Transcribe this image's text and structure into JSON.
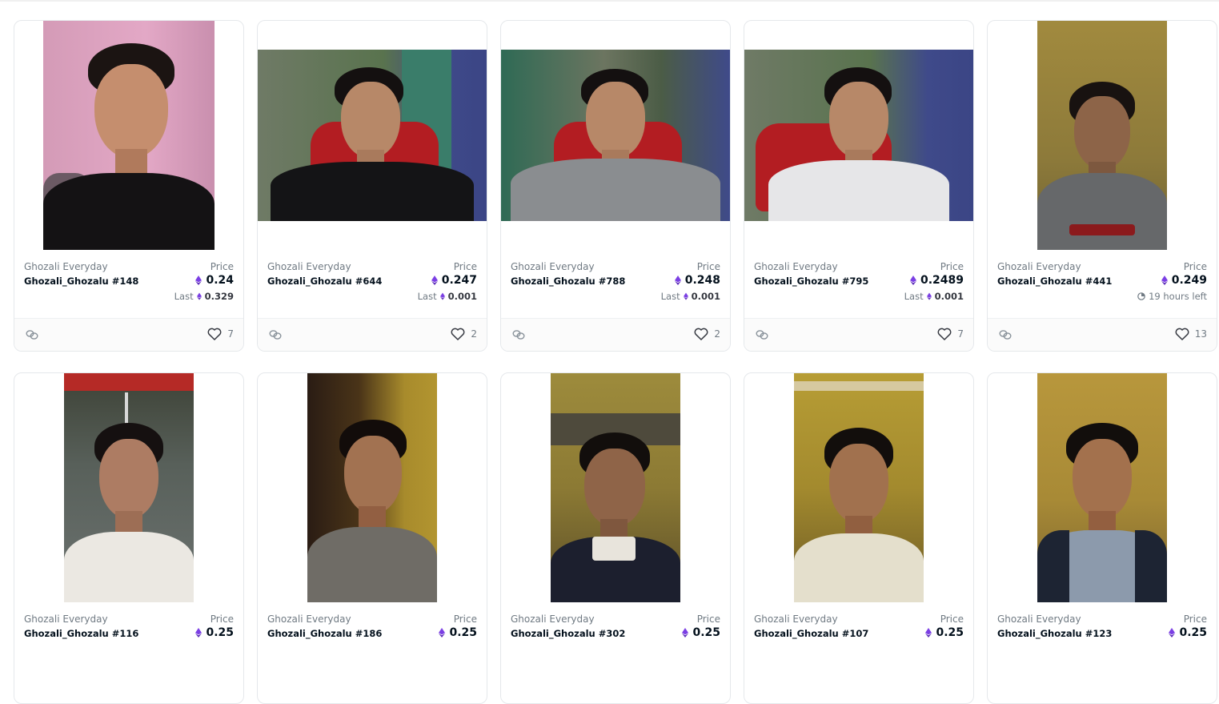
{
  "labels": {
    "price": "Price",
    "last": "Last"
  },
  "colors": {
    "eth_purple": "#7b3fe4",
    "muted": "#707a83",
    "ink": "#04111d"
  },
  "icons": {
    "currency": "ethereum-icon",
    "bundle": "chain-link-icon",
    "favorite": "heart-icon",
    "timer": "clock-icon"
  },
  "cards": [
    {
      "collection": "Ghozali Everyday",
      "token": "Ghozali_Ghozalu #148",
      "price": "0.24",
      "last": "0.329",
      "likes": "7"
    },
    {
      "collection": "Ghozali Everyday",
      "token": "Ghozali_Ghozalu #644",
      "price": "0.247",
      "last": "0.001",
      "likes": "2"
    },
    {
      "collection": "Ghozali Everyday",
      "token": "Ghozali_Ghozalu #788",
      "price": "0.248",
      "last": "0.001",
      "likes": "2"
    },
    {
      "collection": "Ghozali Everyday",
      "token": "Ghozali_Ghozalu #795",
      "price": "0.2489",
      "last": "0.001",
      "likes": "7"
    },
    {
      "collection": "Ghozali Everyday",
      "token": "Ghozali_Ghozalu #441",
      "price": "0.249",
      "time_left": "19 hours left",
      "likes": "13"
    },
    {
      "collection": "Ghozali Everyday",
      "token": "Ghozali_Ghozalu #116",
      "price": "0.25"
    },
    {
      "collection": "Ghozali Everyday",
      "token": "Ghozali_Ghozalu #186",
      "price": "0.25"
    },
    {
      "collection": "Ghozali Everyday",
      "token": "Ghozali_Ghozalu #302",
      "price": "0.25"
    },
    {
      "collection": "Ghozali Everyday",
      "token": "Ghozali_Ghozalu #107",
      "price": "0.25"
    },
    {
      "collection": "Ghozali Everyday",
      "token": "Ghozali_Ghozalu #123",
      "price": "0.25"
    }
  ]
}
